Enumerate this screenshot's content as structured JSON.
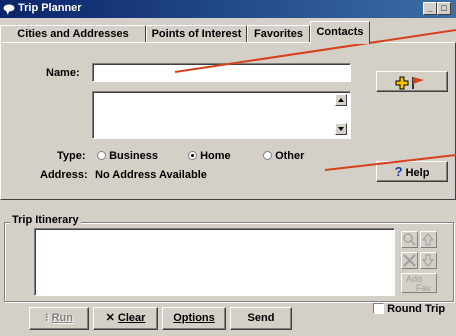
{
  "window": {
    "title": "Trip Planner",
    "minimize": "_",
    "restore": "□"
  },
  "tabs": [
    "Cities and Addresses",
    "Points of Interest",
    "Favorites",
    "Contacts"
  ],
  "contact": {
    "name_label": "Name:",
    "name_value": "",
    "address_value": "",
    "type_label": "Type:",
    "type_options": [
      "Business",
      "Home",
      "Other"
    ],
    "type_selected": "Home",
    "address_label": "Address:",
    "address_text": "No Address Available"
  },
  "buttons": {
    "help": "Help",
    "help_icon": "?",
    "run": "Run",
    "clear": "Clear",
    "options": "Options",
    "send": "Send"
  },
  "itinerary": {
    "label": "Trip Itinerary",
    "add_fav_top": "Add",
    "add_fav_sub": "Fav",
    "round_trip_label": "Round Trip",
    "round_trip_checked": false
  },
  "colors": {
    "title_start": "#0a246a",
    "title_end": "#3a6ea5",
    "accent_red": "#d8401c",
    "help_blue": "#1f3aa8"
  }
}
